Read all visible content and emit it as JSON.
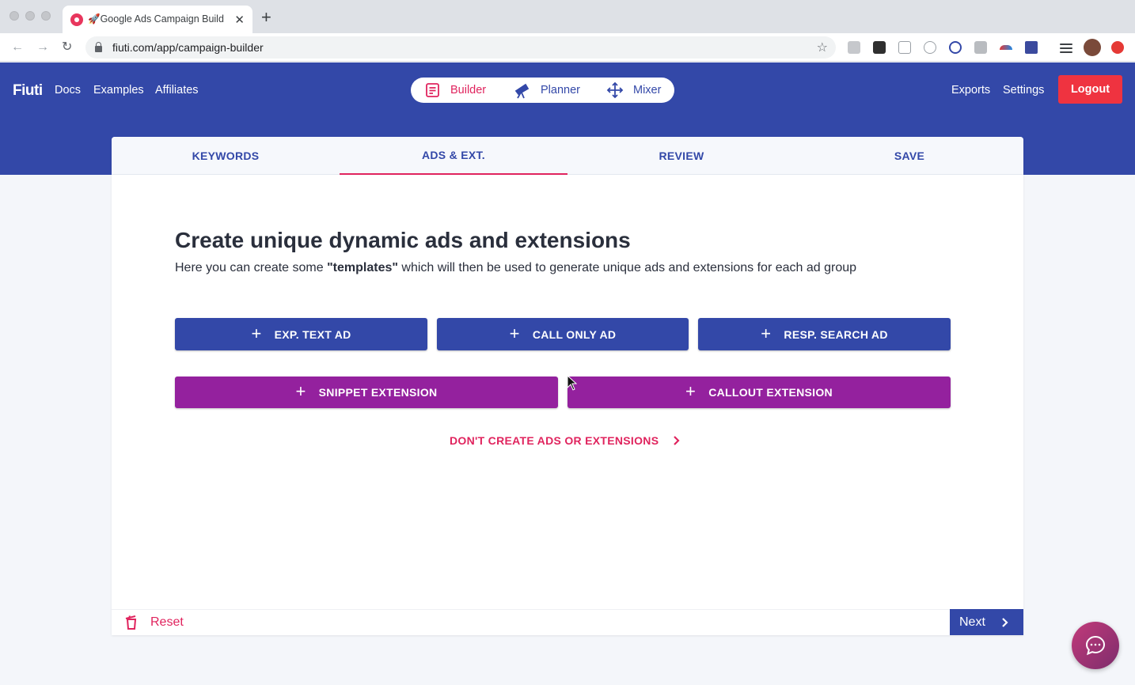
{
  "browser": {
    "tab_title": "🚀Google Ads Campaign Build",
    "tab_close": "✕",
    "new_tab": "+",
    "url": "fiuti.com/app/campaign-builder",
    "back": "←",
    "forward": "→",
    "reload": "↻",
    "bookmark": "☆"
  },
  "header": {
    "brand": "Fiuti",
    "links": [
      "Docs",
      "Examples",
      "Affiliates"
    ],
    "modes": [
      {
        "label": "Builder",
        "icon": "builder-list-icon",
        "active": true
      },
      {
        "label": "Planner",
        "icon": "telescope-icon",
        "active": false
      },
      {
        "label": "Mixer",
        "icon": "arrows-move-icon",
        "active": false
      }
    ],
    "right_links": [
      "Exports",
      "Settings"
    ],
    "logout_label": "Logout"
  },
  "steps": [
    {
      "label": "KEYWORDS",
      "active": false
    },
    {
      "label": "ADS & EXT.",
      "active": true
    },
    {
      "label": "REVIEW",
      "active": false
    },
    {
      "label": "SAVE",
      "active": false
    }
  ],
  "main": {
    "title": "Create unique dynamic ads and extensions",
    "subtitle_pre": "Here you can create some ",
    "subtitle_bold": "\"templates\"",
    "subtitle_post": " which will then be used to generate unique ads and extensions for each ad group",
    "ad_buttons": [
      "EXP. TEXT AD",
      "CALL ONLY AD",
      "RESP. SEARCH AD"
    ],
    "extension_buttons": [
      "SNIPPET EXTENSION",
      "CALLOUT EXTENSION"
    ],
    "plus": "+",
    "skip_label": "DON'T CREATE ADS OR EXTENSIONS"
  },
  "footer": {
    "reset_label": "Reset",
    "next_label": "Next"
  },
  "colors": {
    "primary": "#3348a8",
    "accent": "#e0245e",
    "extension": "#94219e",
    "danger": "#ef3340"
  }
}
